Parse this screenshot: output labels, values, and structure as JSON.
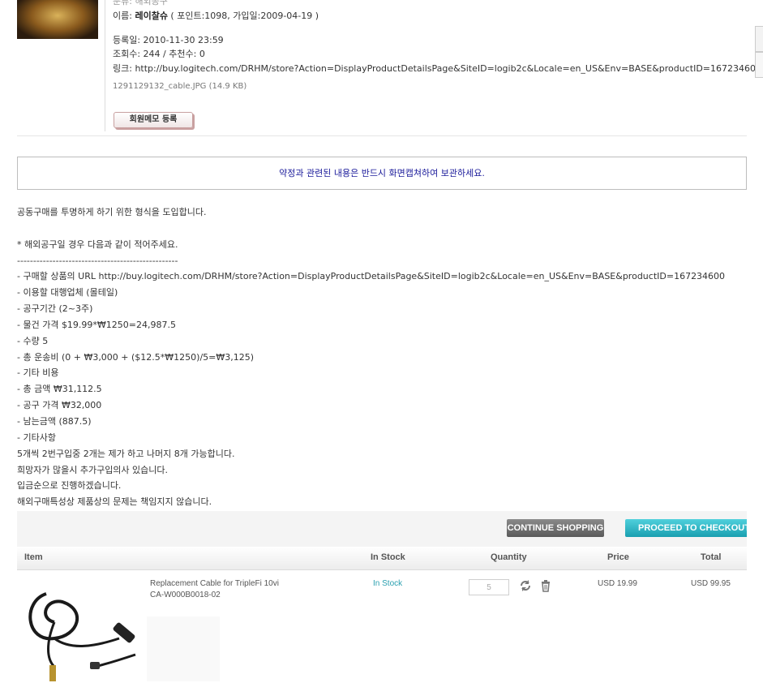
{
  "post": {
    "partial_top": "분류: 해외공구",
    "author_label": "이름: ",
    "author_name": "레이찰슈",
    "author_info": " ( 포인트:1098, 가입일:2009-04-19 )",
    "registered": "등록일: 2010-11-30 23:59",
    "views": "조회수: 244 / 추천수: 0",
    "link": "링크: http://buy.logitech.com/DRHM/store?Action=DisplayProductDetailsPage&SiteID=logib2c&Locale=en_US&Env=BASE&productID=16723460",
    "attachment": "1291129132_cable.JPG (14.9 KB)",
    "memo_button": "회원메모 등록"
  },
  "notice": "약정과 관련된 내용은 반드시 화면캡쳐하여 보관하세요.",
  "body_lines": [
    "공동구매를 투명하게 하기 위한 형식을 도입합니다.",
    "",
    "* 해외공구일 경우 다음과 같이 적어주세요.",
    "--------------------------------------------------",
    "- 구매할 상품의 URL  http://buy.logitech.com/DRHM/store?Action=DisplayProductDetailsPage&SiteID=logib2c&Locale=en_US&Env=BASE&productID=167234600",
    "- 이용할 대행업체 (몰테일)",
    "- 공구기간 (2~3주)",
    "- 물건 가격 $19.99*₩1250=24,987.5",
    "- 수량 5",
    "- 총 운송비 (0 + ₩3,000 + ($12.5*₩1250)/5=₩3,125)",
    "- 기타 비용",
    "- 총 금액 ₩31,112.5",
    "- 공구 가격 ₩32,000",
    "- 남는금액 (887.5)",
    "- 기타사항",
    "5개씩 2번구입중 2개는 제가 하고 나머지 8개 가능합니다.",
    "희망자가 많을시 추가구입의사 있습니다.",
    "입금순으로 진행하겠습니다.",
    "해외구매특성상 제품상의 문제는 책임지지 않습니다."
  ],
  "cart": {
    "continue_label": "CONTINUE SHOPPING",
    "checkout_label": "PROCEED TO CHECKOUT",
    "headers": {
      "item": "Item",
      "in_stock": "In Stock",
      "quantity": "Quantity",
      "price": "Price",
      "total": "Total"
    },
    "row": {
      "name": "Replacement Cable for TripleFi 10vi",
      "sku": "CA-W000B0018-02",
      "stock": "In Stock",
      "quantity": "5",
      "price": "USD 19.99",
      "total": "USD 99.95"
    }
  },
  "colors": {
    "notice_text": "#1a1a9a",
    "checkout_button": "#1a9fb0",
    "continue_button": "#5a5a5a",
    "in_stock": "#2aa0b0"
  },
  "icons": [
    "refresh-icon",
    "trash-icon"
  ]
}
